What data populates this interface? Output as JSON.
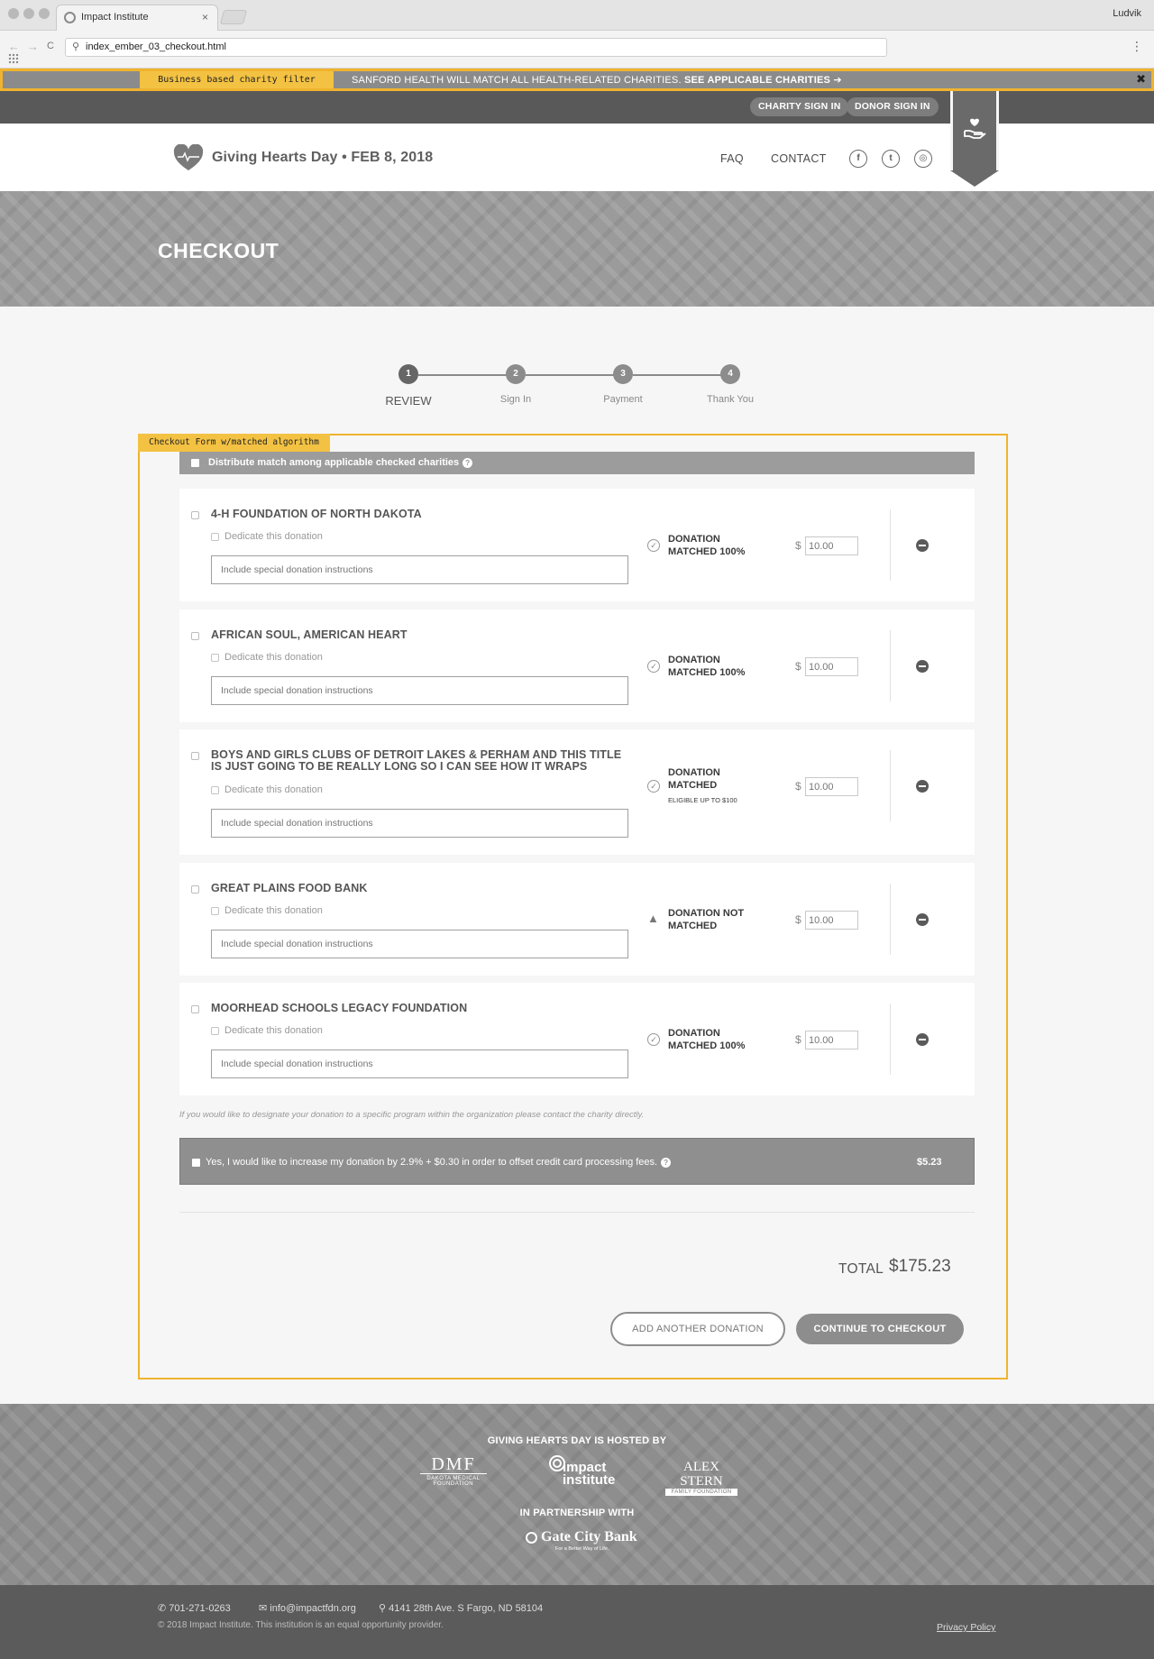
{
  "browser": {
    "tab_title": "Impact Institute",
    "tab_close": "×",
    "user_name": "Ludvik",
    "url": "index_ember_03_checkout.html",
    "back_icon": "←",
    "forward_icon": "→",
    "reload_icon": "C",
    "menu_icon": "⋮",
    "search_icon": "⚲"
  },
  "filter_banner": {
    "tag": "Business based charity filter",
    "message": "SANFORD HEALTH WILL MATCH ALL HEALTH-RELATED CHARITIES.",
    "link": "SEE APPLICABLE CHARITIES",
    "link_icon": "➔",
    "close": "✖"
  },
  "topbar": {
    "charity_sign_in": "CHARITY SIGN IN",
    "donor_sign_in": "DONOR SIGN IN",
    "ribbon_icon": "hand-heart-icon"
  },
  "header": {
    "logo_text": "Giving Hearts Day • FEB 8, 2018",
    "nav": {
      "faq": "FAQ",
      "contact": "CONTACT"
    },
    "social": {
      "facebook": "f",
      "twitter": "t",
      "instagram": "◎"
    }
  },
  "hero": {
    "title": "CHECKOUT"
  },
  "steps": [
    {
      "number": "1",
      "label": "REVIEW"
    },
    {
      "number": "2",
      "label": "Sign In"
    },
    {
      "number": "3",
      "label": "Payment"
    },
    {
      "number": "4",
      "label": "Thank You"
    }
  ],
  "form": {
    "tag": "Checkout Form w/matched algorithm",
    "distribute_label": "Distribute match among applicable checked charities",
    "help": "?",
    "donations": [
      {
        "name": "4-H FOUNDATION OF NORTH DAKOTA",
        "dedicate": "Dedicate this donation",
        "instructions_placeholder": "Include special donation instructions",
        "status_line1": "DONATION",
        "status_line2": "MATCHED 100%",
        "status_sub": "",
        "status_icon": "check-circle-icon",
        "currency": "$",
        "amount": "10.00"
      },
      {
        "name": "AFRICAN SOUL, AMERICAN HEART",
        "dedicate": "Dedicate this donation",
        "instructions_placeholder": "Include special donation instructions",
        "status_line1": "DONATION",
        "status_line2": "MATCHED 100%",
        "status_sub": "",
        "status_icon": "check-circle-icon",
        "currency": "$",
        "amount": "10.00"
      },
      {
        "name": "BOYS AND GIRLS CLUBS OF DETROIT LAKES & PERHAM AND THIS TITLE IS JUST GOING TO BE REALLY LONG SO I CAN SEE HOW IT WRAPS",
        "dedicate": "Dedicate this donation",
        "instructions_placeholder": "Include special donation instructions",
        "status_line1": "DONATION",
        "status_line2": "MATCHED",
        "status_sub": "ELIGIBLE UP TO $100",
        "status_icon": "check-circle-icon",
        "currency": "$",
        "amount": "10.00"
      },
      {
        "name": "GREAT PLAINS FOOD BANK",
        "dedicate": "Dedicate this donation",
        "instructions_placeholder": "Include special donation instructions",
        "status_line1": "DONATION NOT",
        "status_line2": "MATCHED",
        "status_sub": "",
        "status_icon": "warning-icon",
        "currency": "$",
        "amount": "10.00"
      },
      {
        "name": "MOORHEAD SCHOOLS LEGACY FOUNDATION",
        "dedicate": "Dedicate this donation",
        "instructions_placeholder": "Include special donation instructions",
        "status_line1": "DONATION",
        "status_line2": "MATCHED 100%",
        "status_sub": "",
        "status_icon": "check-circle-icon",
        "currency": "$",
        "amount": "10.00"
      }
    ],
    "check_glyph": "✓",
    "warn_glyph": "▲",
    "program_note": "If you would like to designate your donation to a specific program within the organization please contact the charity directly.",
    "fee_label": "Yes, I would like to increase my donation by 2.9% + $0.30 in order to offset credit card processing fees.",
    "fee_amount": "$5.23",
    "total_label": "TOTAL",
    "total_value": "$175.23",
    "add_another": "ADD ANOTHER DONATION",
    "continue": "CONTINUE TO CHECKOUT"
  },
  "footer": {
    "hosted_by": "GIVING HEARTS DAY IS HOSTED BY",
    "sponsors": {
      "dmf_mark": "DMF",
      "dmf_name": "DAKOTA MEDICAL FOUNDATION",
      "impact_name": "impact institute",
      "alex_name": "ALEX STERN",
      "alex_sub": "FAMILY FOUNDATION"
    },
    "partnership": "IN PARTNERSHIP WITH",
    "partner_name": "Gate City Bank",
    "partner_tagline": "For a Better Way of Life.",
    "phone": "701-271-0263",
    "email": "info@impactfdn.org",
    "address": "4141 28th Ave. S Fargo, ND 58104",
    "copyright": "© 2018 Impact Institute. This institution is an equal opportunity provider.",
    "privacy": "Privacy Policy",
    "phone_icon": "✆",
    "email_icon": "✉",
    "pin_icon": "⚲"
  },
  "colors": {
    "highlight": "#f0b32e",
    "tag_bg": "#f3c243",
    "dark_gray": "#595959",
    "mid_gray": "#8d8d8d"
  }
}
